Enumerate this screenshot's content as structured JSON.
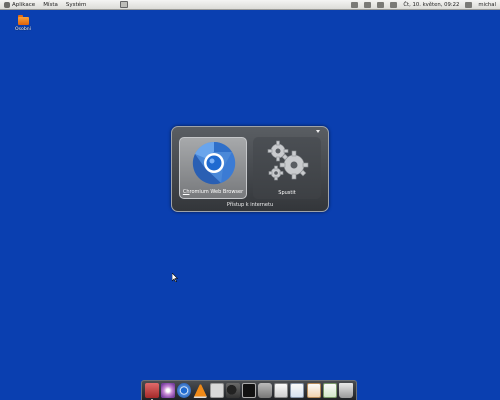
{
  "top_panel": {
    "menu": [
      "Aplikace",
      "Místa",
      "Systém"
    ],
    "clock": "Čt, 10. květen, 09:22",
    "user": "michal"
  },
  "desktop": {
    "icons": [
      {
        "label": "Osobní",
        "icon": "folder-icon"
      }
    ]
  },
  "launcher": {
    "items": [
      {
        "label_accel": "Ch",
        "label_rest": "romium Web Browser",
        "icon": "chromium-icon",
        "selected": true
      },
      {
        "label": "Spustit",
        "icon": "gears-icon",
        "selected": false
      }
    ],
    "category": "Přístup k internetu"
  },
  "dock": {
    "items": [
      "gift-icon",
      "flower-icon",
      "chromium-icon",
      "vlc-icon",
      "document-icon",
      "bird-icon",
      "terminal-icon",
      "drive-icon",
      "text-editor-icon",
      "writer-icon",
      "presentation-icon",
      "calc-icon",
      "trash-icon"
    ]
  },
  "colors": {
    "desktop": "#0a3fb0",
    "panel": "#e8e8e6",
    "launcher": "#44474b"
  }
}
